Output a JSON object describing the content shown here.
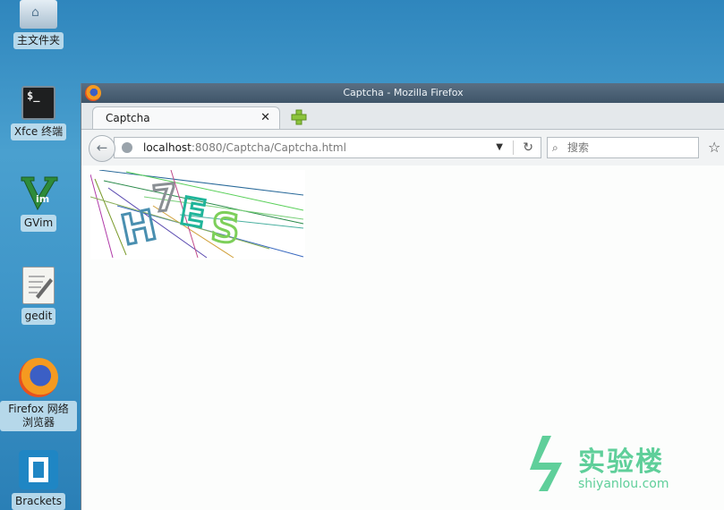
{
  "desktop": {
    "icons": [
      {
        "label": "主文件夹",
        "icon": "home-folder-icon"
      },
      {
        "label": "Xfce 终端",
        "icon": "terminal-icon"
      },
      {
        "label": "GVim",
        "icon": "gvim-icon"
      },
      {
        "label": "gedit",
        "icon": "gedit-icon"
      },
      {
        "label": "Firefox 网络浏览器",
        "icon": "firefox-icon"
      },
      {
        "label": "Brackets",
        "icon": "brackets-icon"
      }
    ],
    "terminal_glyph": "$_",
    "home_glyph": "⌂"
  },
  "window": {
    "title": "Captcha - Mozilla Firefox",
    "tab": {
      "label": "Captcha",
      "close": "✕"
    },
    "url": {
      "host": "localhost",
      "rest": ":8080/Captcha/Captcha.html"
    },
    "search_placeholder": "搜索",
    "back_glyph": "←",
    "reload_glyph": "↻",
    "dropdown_glyph": "▼",
    "search_glyph": "🔍",
    "star_glyph": "☆"
  },
  "captcha": {
    "chars": [
      "H",
      "7",
      "E",
      "S"
    ],
    "colors": [
      "#4a8fb0",
      "#8a8f94",
      "#1fb59a",
      "#7dcf5a"
    ]
  },
  "watermark": {
    "title": "实验楼",
    "subtitle": "shiyanlou.com",
    "color": "#5fcf9a"
  }
}
